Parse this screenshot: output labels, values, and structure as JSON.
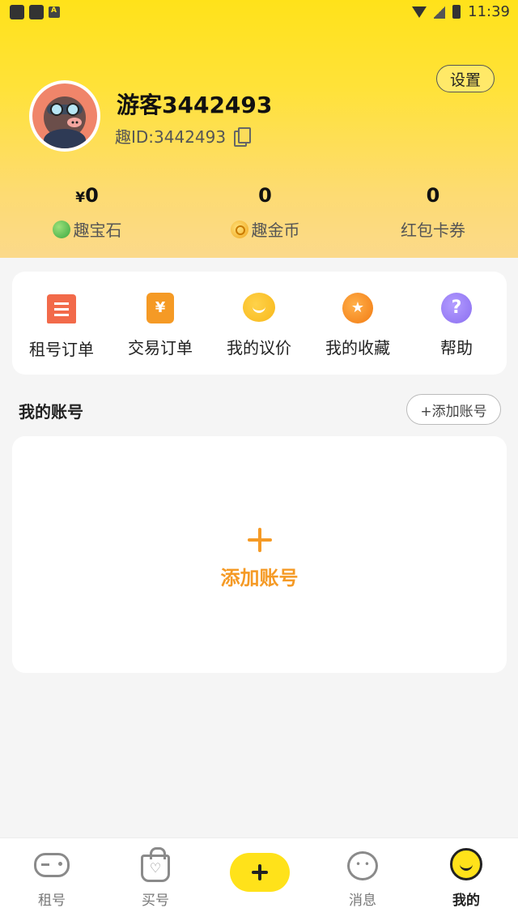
{
  "status_bar": {
    "time": "11:39"
  },
  "header": {
    "settings_label": "设置",
    "username": "游客3442493",
    "user_id": "趣ID:3442493"
  },
  "stats": [
    {
      "value": "0",
      "currency": "¥",
      "label": "趣宝石",
      "icon": "gem-icon"
    },
    {
      "value": "0",
      "label": "趣金币",
      "icon": "coin-icon"
    },
    {
      "value": "0",
      "label": "红包卡券"
    }
  ],
  "menu": [
    {
      "label": "租号订单",
      "icon": "receipt-icon"
    },
    {
      "label": "交易订单",
      "icon": "yen-order-icon",
      "glyph": "¥"
    },
    {
      "label": "我的议价",
      "icon": "smile-bubble-icon"
    },
    {
      "label": "我的收藏",
      "icon": "star-icon",
      "glyph": "★"
    },
    {
      "label": "帮助",
      "icon": "help-icon",
      "glyph": "?"
    }
  ],
  "accounts": {
    "title": "我的账号",
    "add_button_label": "+添加账号",
    "empty_action_label": "添加账号"
  },
  "bottom_nav": [
    {
      "label": "租号",
      "icon": "gamepad-icon"
    },
    {
      "label": "买号",
      "icon": "shopping-bag-icon"
    },
    {
      "label": "消息",
      "icon": "chat-icon"
    },
    {
      "label": "我的",
      "icon": "profile-smile-icon",
      "active": true
    }
  ],
  "colors": {
    "brand_yellow": "#ffe21a",
    "accent_orange": "#f59a25"
  }
}
